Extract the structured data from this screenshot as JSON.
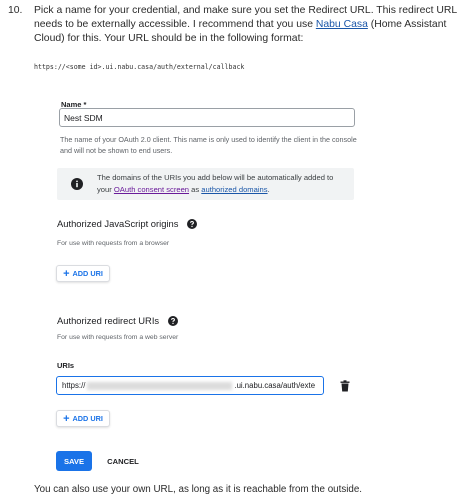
{
  "step": {
    "number": "10.",
    "text_before_link": "Pick a name for your credential, and make sure you set the Redirect URL. This redirect URL needs to be externally accessible. I recommend that you use ",
    "link": "Nabu Casa",
    "text_after_link": " (Home Assistant Cloud) for this. Your URL should be in the following format:"
  },
  "code_sample": "https://<some id>.ui.nabu.casa/auth/external/callback",
  "form": {
    "name_label": "Name *",
    "name_value": "Nest SDM",
    "name_hint": "The name of your OAuth 2.0 client. This name is only used to identify the client in the console and will not be shown to end users.",
    "info": {
      "text_before": "The domains of the URIs you add below will be automatically added to your ",
      "link1": "OAuth consent screen",
      "text_middle": " as ",
      "link2": "authorized domains",
      "text_end": "."
    },
    "js_origins": {
      "title": "Authorized JavaScript origins",
      "subtitle": "For use with requests from a browser",
      "add_label": "ADD URI"
    },
    "redirect_uris": {
      "title": "Authorized redirect URIs",
      "subtitle": "For use with requests from a web server",
      "uris_label": "URIs",
      "uri_prefix": "https://",
      "uri_suffix": ".ui.nabu.casa/auth/exte",
      "add_label": "ADD URI"
    },
    "save_label": "SAVE",
    "cancel_label": "CANCEL"
  },
  "footer": "You can also use your own URL, as long as it is reachable from the outside.",
  "colors": {
    "accent": "#1a73e8",
    "link": "#1a56a8",
    "visited_link": "#6a1b9a",
    "info_bg": "#f1f3f4"
  },
  "icons": {
    "info": "info-icon",
    "help": "help-icon",
    "delete": "trash-icon",
    "add": "plus-icon"
  }
}
